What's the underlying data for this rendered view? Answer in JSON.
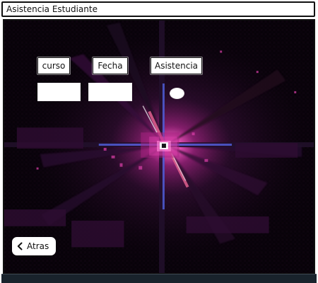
{
  "window": {
    "title": "Asistencia Estudiante"
  },
  "form": {
    "labels": {
      "course": "curso",
      "date": "Fecha",
      "attendance": "Asistencia"
    },
    "fields": {
      "course": {
        "value": "",
        "placeholder": ""
      },
      "date": {
        "value": "",
        "placeholder": ""
      }
    },
    "attendance_indicator": {
      "color": "#ffffff"
    }
  },
  "navigation": {
    "back_label": "Atras",
    "back_icon": "chevron-left-icon"
  },
  "theme": {
    "background": "#070208",
    "starburst_core": "#ffffff",
    "starburst_magenta": "#b1288f",
    "starburst_blue": "#4f5ed8",
    "button_background": "#ffffff",
    "text": "#111111"
  }
}
